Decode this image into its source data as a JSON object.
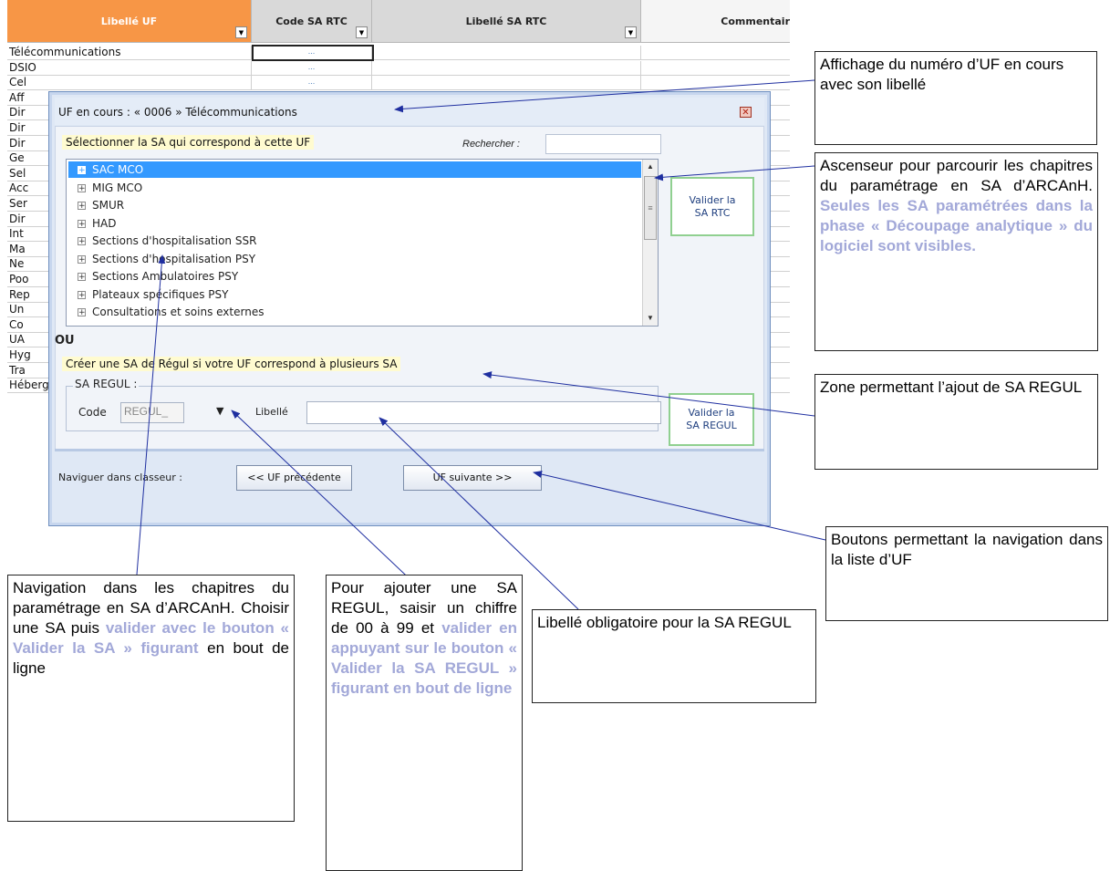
{
  "sheet": {
    "headers": [
      "Libellé UF",
      "Code SA RTC",
      "Libellé SA RTC",
      "Commentair"
    ],
    "rows": [
      "Télécommunications",
      "DSIO",
      "Cel",
      "Aff",
      "Dir",
      "Dir",
      "Dir",
      "Ge",
      "Sel",
      "Acc",
      "Ser",
      "Dir",
      "Int",
      "Ma",
      "Ne",
      "Poo",
      "Rep",
      "Un",
      "Co",
      "UA",
      "Hyg",
      "Tra",
      "Hébergement médical"
    ],
    "ellipsis": "..."
  },
  "dialog": {
    "title": "UF en cours : « 0006 » Télécommunications",
    "close_glyph": "✕",
    "select_label": "Sélectionner la SA qui correspond à cette UF",
    "search_label": "Rechercher :",
    "tree_items": [
      "SAC MCO",
      "MIG MCO",
      "SMUR",
      "HAD",
      "Sections d'hospitalisation SSR",
      "Sections d'hospitalisation PSY",
      "Sections Ambulatoires PSY",
      "Plateaux spécifiques PSY",
      "Consultations et soins externes"
    ],
    "validate_rtc": "Valider la SA RTC",
    "ou": "OU",
    "create_label": "Créer une SA de Régul si votre UF correspond à plusieurs SA",
    "regul_legend": "SA REGUL :",
    "code_label": "Code",
    "code_value": "REGUL_",
    "libelle_label": "Libellé",
    "validate_regul": "Valider la SA REGUL",
    "nav_label": "Naviguer dans classeur :",
    "prev_button": "<< UF précédente",
    "next_button": "UF suivante >>"
  },
  "annotations": {
    "uf_display": "Affichage du numéro d’UF en cours avec son libellé",
    "scroll_plain": "Ascenseur pour parcourir les chapitres du paramétrage en SA d’ARCAnH.",
    "scroll_hl": "Seules les SA paramétrées dans la phase « Découpage analytique » du logiciel sont visibles.",
    "regul_zone": "Zone permettant l’ajout de SA REGUL",
    "nav_buttons": "Boutons permettant la navigation dans la liste d’UF",
    "tree_nav_plain": "Navigation dans les chapitres du paramétrage en SA d’ARCAnH. Choisir une SA puis",
    "tree_nav_hl": "valider avec le bouton « Valider la SA » figurant",
    "tree_nav_end": "en bout de ligne",
    "add_regul_plain": "Pour ajouter une SA REGUL, saisir un chiffre de 00 à 99 et",
    "add_regul_hl": "valider en appuyant sur le bouton « Valider la SA REGUL » figurant en bout de ligne",
    "libelle_required": "Libellé obligatoire pour la SA REGUL"
  },
  "colors": {
    "header_orange": "#f79646",
    "highlight": "#a2a8d8",
    "arrow": "#1f2fa0",
    "selection": "#3399ff"
  }
}
